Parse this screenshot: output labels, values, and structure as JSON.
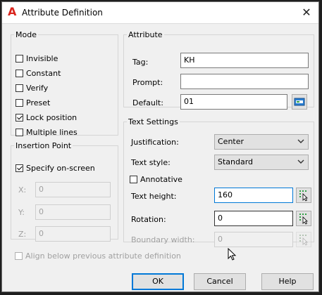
{
  "window": {
    "title": "Attribute Definition",
    "close_glyph": "✕",
    "app_icon_glyph": "A"
  },
  "mode": {
    "legend": "Mode",
    "options": [
      {
        "label": "Invisible",
        "checked": false
      },
      {
        "label": "Constant",
        "checked": false
      },
      {
        "label": "Verify",
        "checked": false
      },
      {
        "label": "Preset",
        "checked": false
      },
      {
        "label": "Lock position",
        "checked": true
      },
      {
        "label": "Multiple lines",
        "checked": false
      }
    ]
  },
  "insertion": {
    "legend": "Insertion Point",
    "specify_label": "Specify on-screen",
    "specify_checked": true,
    "x_label": "X:",
    "x_value": "0",
    "y_label": "Y:",
    "y_value": "0",
    "z_label": "Z:",
    "z_value": "0"
  },
  "attribute": {
    "legend": "Attribute",
    "tag_label": "Tag:",
    "tag_value": "KH",
    "prompt_label": "Prompt:",
    "prompt_value": "",
    "default_label": "Default:",
    "default_value": "01"
  },
  "text_settings": {
    "legend": "Text Settings",
    "justification_label": "Justification:",
    "justification_value": "Center",
    "style_label": "Text style:",
    "style_value": "Standard",
    "annotative_label": "Annotative",
    "annotative_checked": false,
    "height_label": "Text height:",
    "height_value": "160",
    "rotation_label": "Rotation:",
    "rotation_value": "0",
    "boundary_label": "Boundary width:",
    "boundary_value": "0"
  },
  "align_label": "Align below previous attribute definition",
  "buttons": {
    "ok": "OK",
    "cancel": "Cancel",
    "help": "Help"
  }
}
